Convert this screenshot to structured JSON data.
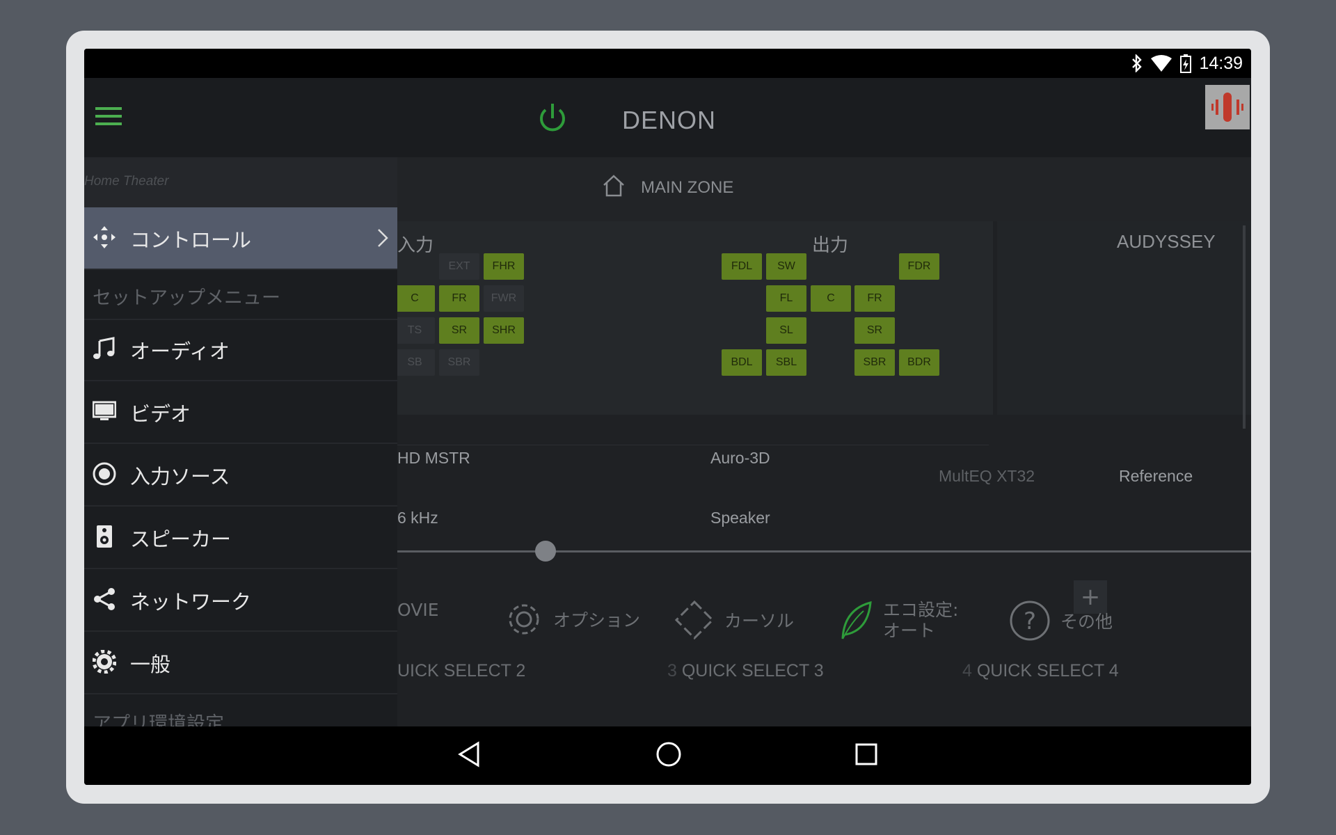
{
  "status_bar": {
    "time": "14:39"
  },
  "app_bar": {
    "brand": "DENON"
  },
  "zone": {
    "label": "MAIN ZONE"
  },
  "panels": {
    "input": {
      "title": "入力",
      "chips": [
        {
          "label": "EXT",
          "on": false
        },
        {
          "label": "FHR",
          "on": true
        },
        {
          "label": "C",
          "on": true
        },
        {
          "label": "FR",
          "on": true
        },
        {
          "label": "FWR",
          "on": false
        },
        {
          "label": "TS",
          "on": false
        },
        {
          "label": "SR",
          "on": true
        },
        {
          "label": "SHR",
          "on": true
        },
        {
          "label": "SB",
          "on": false
        },
        {
          "label": "SBR",
          "on": false
        }
      ]
    },
    "output": {
      "title": "出力",
      "chips": [
        {
          "label": "FDL",
          "on": true
        },
        {
          "label": "SW",
          "on": true
        },
        {
          "label": "FDR",
          "on": true
        },
        {
          "label": "FL",
          "on": true
        },
        {
          "label": "C",
          "on": true
        },
        {
          "label": "FR",
          "on": true
        },
        {
          "label": "SL",
          "on": true
        },
        {
          "label": "SR",
          "on": true
        },
        {
          "label": "BDL",
          "on": true
        },
        {
          "label": "SBL",
          "on": true
        },
        {
          "label": "SBR",
          "on": true
        },
        {
          "label": "BDR",
          "on": true
        }
      ]
    },
    "audyssey": {
      "title": "AUDYSSEY"
    }
  },
  "info": {
    "signal": "HD MSTR",
    "mode": "Auro-3D",
    "rate": "6 kHz",
    "output": "Speaker",
    "multeq_label": "MultEQ XT32",
    "multeq_value": "Reference"
  },
  "volume": {
    "level": 0.175
  },
  "functions": {
    "movie": "OVIE",
    "option": "オプション",
    "cursor": "カーソル",
    "eco_line1": "エコ設定:",
    "eco_line2": "オート",
    "other": "その他"
  },
  "quick_select": {
    "qs2": "UICK SELECT 2",
    "qs3_num": "3",
    "qs3": "QUICK SELECT 3",
    "qs4_num": "4",
    "qs4": "QUICK SELECT 4"
  },
  "drawer": {
    "header": "Home Theater",
    "control": "コントロール",
    "setup_section": "セットアップメニュー",
    "audio": "オーディオ",
    "video": "ビデオ",
    "input_source": "入力ソース",
    "speaker": "スピーカー",
    "network": "ネットワーク",
    "general": "一般",
    "app_section": "アプリ環境設定"
  },
  "colors": {
    "accent_green": "#4caf50",
    "chip_on": "#5f7f1f",
    "active_item": "#545b6b"
  }
}
